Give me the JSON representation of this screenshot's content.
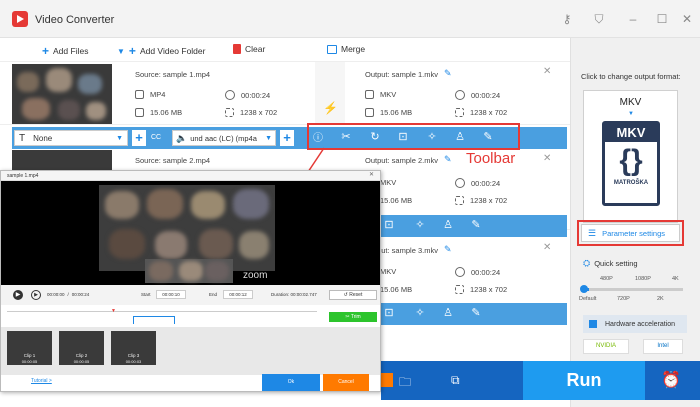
{
  "app": {
    "title": "Video Converter"
  },
  "toolbar": {
    "add_files": "Add Files",
    "add_folder": "Add Video Folder",
    "clear": "Clear",
    "merge": "Merge"
  },
  "rows": [
    {
      "source": "Source: sample 1.mp4",
      "format": "MP4",
      "duration": "00:00:24",
      "size": "15.06 MB",
      "resolution": "1238 x 702",
      "output": "Output: sample 1.mkv",
      "out_format": "MKV",
      "out_duration": "00:00:24",
      "out_size": "15.06 MB",
      "out_resolution": "1238 x 702"
    },
    {
      "source": "Source: sample 2.mp4",
      "output": "Output: sample 2.mkv",
      "out_format": "MKV",
      "out_duration": "00:00:24",
      "out_size": "15.06 MB",
      "out_resolution": "1238 x 702"
    },
    {
      "output": "Output: sample 3.mkv",
      "out_format": "MKV",
      "out_duration": "00:00:24",
      "out_size": "15.06 MB",
      "out_resolution": "1238 x 702"
    }
  ],
  "editbar": {
    "subtitle_value": "None",
    "audio_value": "und aac (LC) (mp4a"
  },
  "annotation": {
    "toolbar_label": "Toolbar",
    "color": "#e53935"
  },
  "right_panel": {
    "hint": "Click to change output format:",
    "format": "MKV",
    "logo_text": "MATROŠKA",
    "param_settings": "Parameter settings",
    "quick_setting": "Quick setting",
    "quality_labels": [
      "480P",
      "1080P",
      "4K"
    ],
    "quality_labels_bottom": [
      "Default",
      "720P",
      "2K"
    ],
    "hw_accel": "Hardware acceleration",
    "gpu_labels": [
      "NVIDIA",
      "Intel"
    ]
  },
  "bottom": {
    "run": "Run",
    "run_color": "#1e9bf0"
  },
  "dialog": {
    "title": "sample 1.mp4",
    "zoom": "zoom",
    "time_current": "00:00:00",
    "time_total": "00:00:24",
    "start_label": "Start",
    "start_value": "00:00:10",
    "end_label": "End",
    "end_value": "00:00:12",
    "duration": "Duration: 00:00:02.747",
    "reset": "Reset",
    "trim": "Trim",
    "clips": [
      {
        "label": "Clip 1",
        "time": "00:00:05"
      },
      {
        "label": "Clip 2",
        "time": "00:00:05"
      },
      {
        "label": "Clip 3",
        "time": "00:00:03"
      }
    ],
    "tutorial": "Tutorial >",
    "ok": "Ok",
    "cancel": "Cancel"
  }
}
